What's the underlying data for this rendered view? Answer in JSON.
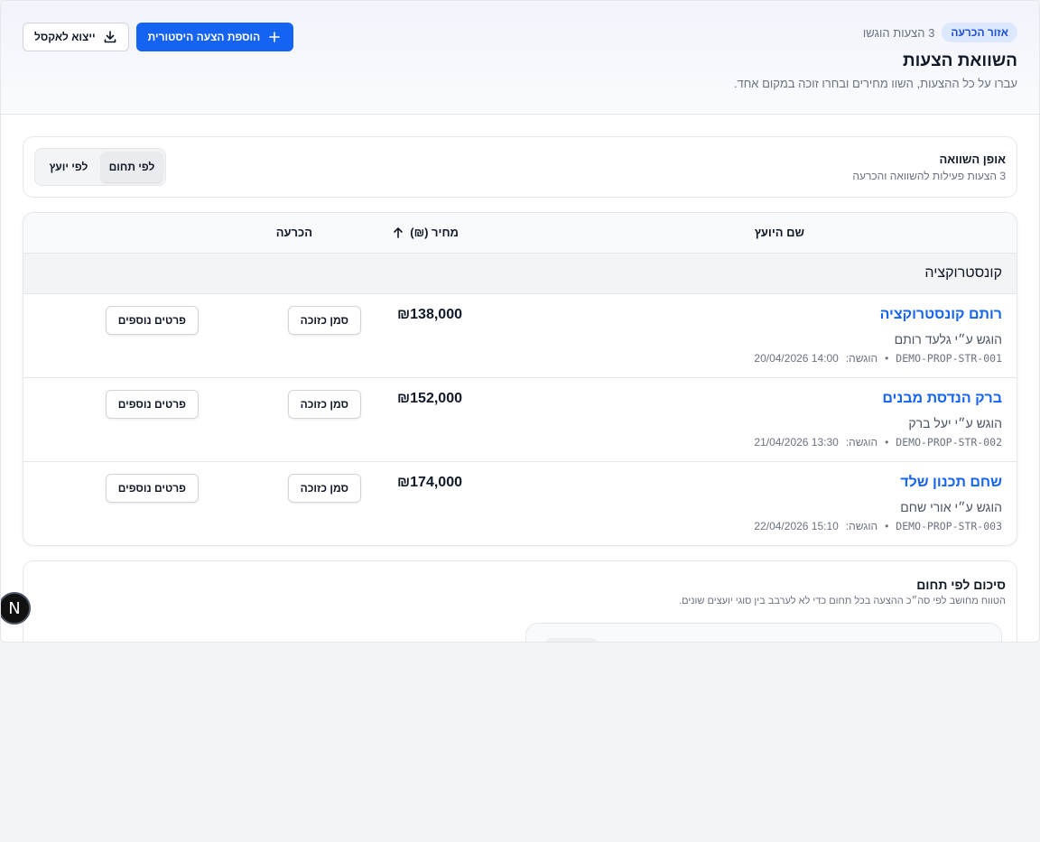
{
  "header": {
    "badge": "אזור הכרעה",
    "count_text": "3 הצעות הוגשו",
    "title": "השוואת הצעות",
    "subtitle": "עברו על כל ההצעות, השוו מחירים ובחרו זוכה במקום אחד.",
    "add_button": "הוספת הצעה היסטורית",
    "export_button": "ייצוא לאקסל"
  },
  "compare": {
    "title": "אופן השוואה",
    "subtitle": "3 הצעות פעילות להשוואה והכרעה",
    "options": [
      "לפי תחום",
      "לפי יועץ"
    ],
    "selected": "לפי תחום"
  },
  "table": {
    "col_name": "שם היועץ",
    "col_price": "מחיר (₪)",
    "col_decision": "הכרעה",
    "group": "קונסטרוקציה",
    "submitted_label": "הוגשה:",
    "win_label": "סמן כזוכה",
    "more_label": "פרטים נוספים",
    "rows": [
      {
        "vendor": "רותם קונסטרוקציה",
        "by": "הוגש ע״י גלעד רותם",
        "code": "DEMO-PROP-STR-001",
        "date": "20/04/2026 14:00",
        "price": "₪138,000"
      },
      {
        "vendor": "ברק הנדסת מבנים",
        "by": "הוגש ע״י יעל ברק",
        "code": "DEMO-PROP-STR-002",
        "date": "21/04/2026 13:30",
        "price": "₪152,000"
      },
      {
        "vendor": "שחם תכנון שלד",
        "by": "הוגש ע״י אורי שחם",
        "code": "DEMO-PROP-STR-003",
        "date": "22/04/2026 15:10",
        "price": "₪174,000"
      }
    ]
  },
  "summary": {
    "title": "סיכום לפי תחום",
    "subtitle": "הטווח מחושב לפי סה״כ ההצעה בכל תחום כדי לא לערבב בין סוגי יועצים שונים."
  },
  "fab": {
    "label": "N"
  },
  "icons": {
    "add": "plus-icon",
    "export": "download-icon",
    "sort": "arrow-up-icon"
  },
  "colors": {
    "primary": "#1463f3",
    "badge_bg": "#dce8fd",
    "badge_text": "#1d4ed8"
  }
}
